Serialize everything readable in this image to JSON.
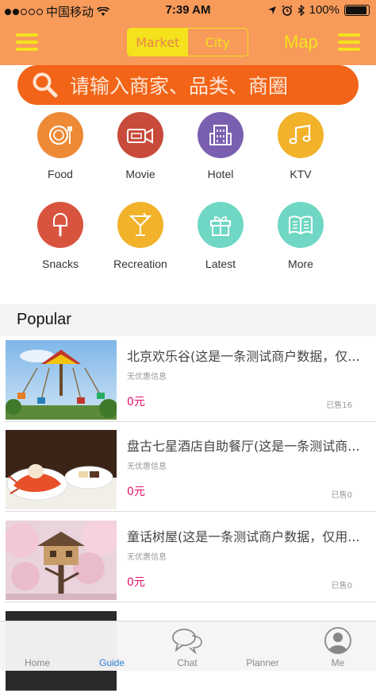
{
  "status_bar": {
    "carrier": "中国移动",
    "time": "7:39 AM",
    "battery": "100%"
  },
  "nav": {
    "segments": [
      "Market",
      "City"
    ],
    "active_segment": "Market",
    "map_label": "Map"
  },
  "search": {
    "placeholder": "请输入商家、品类、商圈"
  },
  "categories": [
    {
      "label": "Food",
      "color": "#ee8a35",
      "icon": "plate-icon"
    },
    {
      "label": "Movie",
      "color": "#c84a3a",
      "icon": "film-camera-icon"
    },
    {
      "label": "Hotel",
      "color": "#7a5fb0",
      "icon": "building-icon"
    },
    {
      "label": "KTV",
      "color": "#f2b22a",
      "icon": "music-note-icon"
    },
    {
      "label": "Snacks",
      "color": "#d9543f",
      "icon": "ice-cream-icon"
    },
    {
      "label": "Recreation",
      "color": "#f2b22a",
      "icon": "cocktail-icon"
    },
    {
      "label": "Latest",
      "color": "#6fd7c4",
      "icon": "gift-icon"
    },
    {
      "label": "More",
      "color": "#6fd7c4",
      "icon": "book-icon"
    }
  ],
  "popular": {
    "title": "Popular",
    "items": [
      {
        "name": "北京欢乐谷(这是一条测试商户数据，仅...",
        "promo": "无优惠信息",
        "price": "0元",
        "sold": "已售16"
      },
      {
        "name": "盘古七星酒店自助餐厅(这是一条测试商...",
        "promo": "无优惠信息",
        "price": "0元",
        "sold": "已售0"
      },
      {
        "name": "童话树屋(这是一条测试商户数据，仅用...",
        "promo": "无优惠信息",
        "price": "0元",
        "sold": "已售0"
      }
    ]
  },
  "tabs": [
    {
      "label": "Home"
    },
    {
      "label": "Guide"
    },
    {
      "label": "Chat"
    },
    {
      "label": "Planner"
    },
    {
      "label": "Me"
    }
  ],
  "colors": {
    "header": "#f79a5a",
    "accent_yellow": "#f4e21c",
    "search_bg": "#f26417",
    "price": "#e0116b",
    "tab_active": "#2a7fd6"
  }
}
